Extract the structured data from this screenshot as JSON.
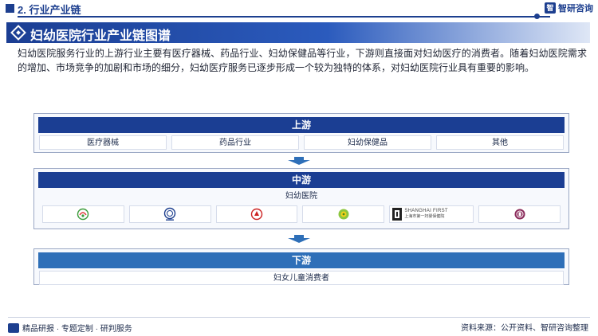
{
  "header": {
    "section_title": "2. 行业产业链",
    "brand_name": "智研咨询",
    "brand_logo_text": "智"
  },
  "banner": {
    "title": "妇幼医院行业产业链图谱"
  },
  "description": "妇幼医院服务行业的上游行业主要有医疗器械、药品行业、妇幼保健品等行业，下游则直接面对妇幼医疗的消费者。随着妇幼医院需求的增加、市场竞争的加剧和市场的细分，妇幼医疗服务已逐步形成一个较为独特的体系，对妇幼医院行业具有重要的影响。",
  "chain": {
    "upstream": {
      "label": "上游",
      "items": [
        "医疗器械",
        "药品行业",
        "妇幼保健品",
        "其他"
      ]
    },
    "midstream": {
      "label": "中游",
      "sub_label": "妇幼医院",
      "logo_texts": [
        "SHANGHAI FIRST",
        "上海市第一妇婴保健院"
      ]
    },
    "downstream": {
      "label": "下游",
      "item": "妇女儿童消费者"
    }
  },
  "colors": {
    "primary": "#1b3e93",
    "accent": "#2e6fb8"
  },
  "footer": {
    "left_text": "精品研报 · 专题定制 · 研判服务",
    "source": "资料来源：公开资料、智研咨询整理"
  }
}
